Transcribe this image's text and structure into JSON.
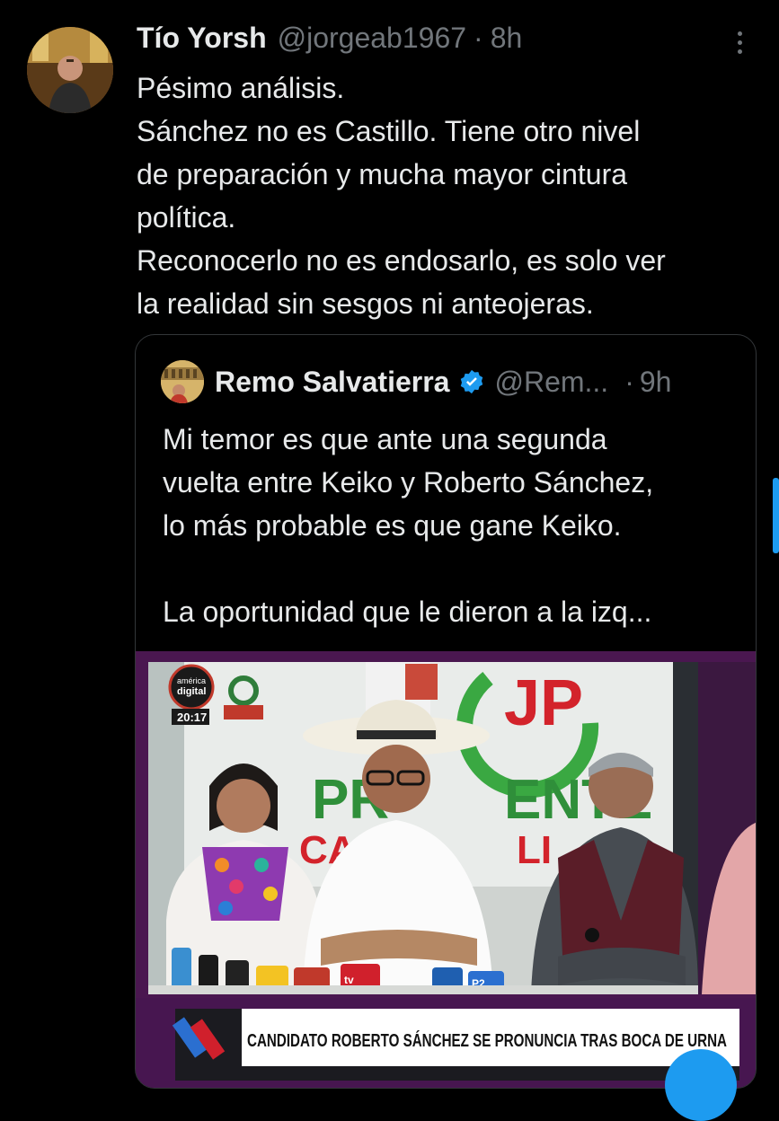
{
  "tweet": {
    "author_name": "Tío Yorsh",
    "handle": "@jorgeab1967",
    "separator": "·",
    "time": "8h",
    "lines": [
      "Pésimo análisis.",
      "Sánchez no es Castillo. Tiene otro nivel",
      "de preparación y mucha mayor cintura",
      "política.",
      "Reconocerlo no es endosarlo, es solo ver",
      "la realidad sin sesgos ni anteojeras."
    ],
    "avatar_icon": "profile-photo"
  },
  "quote": {
    "author_name": "Remo Salvatierra",
    "verified_icon": "verified-badge-icon",
    "handle": "@Rem...",
    "separator": "·",
    "time": "9h",
    "lines": [
      "Mi temor es que ante una segunda",
      "vuelta entre Keiko y Roberto Sánchez,",
      "lo más probable es que gane Keiko.",
      "",
      "La oportunidad que le dieron a la izq..."
    ]
  },
  "media": {
    "channel_logo_line1": "américa",
    "channel_logo_line2": "digital",
    "clock": "20:17",
    "banner_letters_1": "PR",
    "banner_letters_2": "ENTE",
    "banner_letters_3": "CAS",
    "banner_letters_4": "LI",
    "party_logo": "JP",
    "chyron": "CANDIDATO ROBERTO SÁNCHEZ SE PRONUNCIA TRAS BOCA DE URNA",
    "mic_label_1": "tv",
    "mic_label_2": "P2"
  },
  "colors": {
    "background": "#000000",
    "text": "#e7e9ea",
    "secondary": "#71767b",
    "accent": "#1d9bf0",
    "border": "#333639"
  }
}
